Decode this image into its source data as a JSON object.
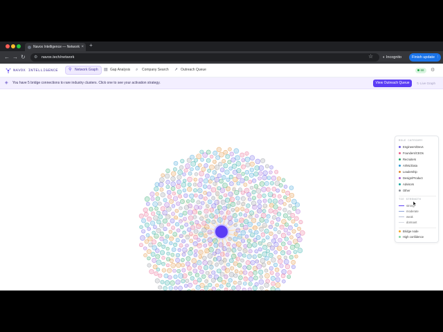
{
  "browser": {
    "tab_title": "Navox Intelligence — Network",
    "url": "navox.tech/network",
    "incognito_label": "Incognito",
    "update_label": "Finish update",
    "new_tab_icon": "plus-icon"
  },
  "app": {
    "brand": "NAVOX INTELLIGENCE",
    "nav": [
      {
        "label": "Network Graph",
        "icon": "network-icon",
        "active": true
      },
      {
        "label": "Gap Analysis",
        "icon": "chart-icon",
        "active": false
      },
      {
        "label": "Company Search",
        "icon": "search-icon",
        "active": false
      },
      {
        "label": "Outreach Queue",
        "icon": "send-icon",
        "active": false
      }
    ],
    "status_badge": "68"
  },
  "banner": {
    "message": "You have 5 bridge connections to rare industry clusters. Click one to see your activation strategy.",
    "queue_button": "View Outreach Queue",
    "graph_button": "Live Graph"
  },
  "graph": {
    "center_color": "#5b3df5",
    "categories": [
      {
        "label": "Engineers/Devs",
        "color": "#6b5be6"
      },
      {
        "label": "Founders/CEOs",
        "color": "#e85d8a"
      },
      {
        "label": "Recruiters",
        "color": "#25a56a"
      },
      {
        "label": "AI/ML/Data",
        "color": "#2f9bd6"
      },
      {
        "label": "Leadership",
        "color": "#e08a2e"
      },
      {
        "label": "Design/Product",
        "color": "#a05ad6"
      },
      {
        "label": "Advisors",
        "color": "#1aa6a0"
      },
      {
        "label": "Other",
        "color": "#8a8f98"
      }
    ]
  },
  "legend": {
    "category_heading": "ROLE CATEGORY",
    "strength_heading": "TIE STRENGTH",
    "strengths": [
      {
        "label": "strong",
        "color": "#5b3df5"
      },
      {
        "label": "moderate",
        "color": "#8aa0d8"
      },
      {
        "label": "weak",
        "color": "#b8c0d8"
      },
      {
        "label": "dormant",
        "color": "#d6d9e2"
      }
    ],
    "bridge_label": "Bridge node",
    "confidence_label": "High confidence",
    "bridge_color": "#f5a623",
    "confidence_color": "#7ed6a2"
  }
}
